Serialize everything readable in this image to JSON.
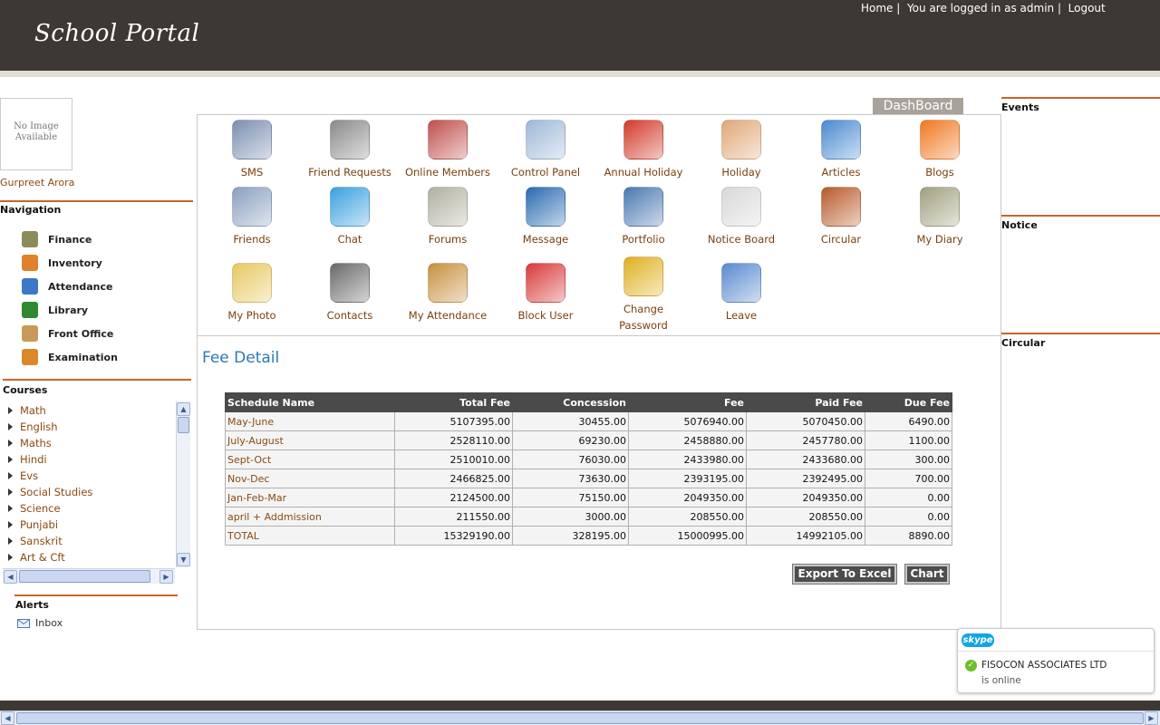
{
  "header": {
    "logo": "School Portal",
    "links": {
      "home": "Home |",
      "logged_in": "You are logged in as admin |",
      "logout": "Logout"
    }
  },
  "profile": {
    "no_image_line1": "No Image",
    "no_image_line2": "Available",
    "name": "Gurpreet Arora"
  },
  "navigation": {
    "title": "Navigation",
    "items": [
      {
        "label": "Finance",
        "icon": "finance-icon",
        "color": "#8c8c5a"
      },
      {
        "label": "Inventory",
        "icon": "inventory-icon",
        "color": "#e0822c"
      },
      {
        "label": "Attendance",
        "icon": "attendance-icon",
        "color": "#3c78c8"
      },
      {
        "label": "Library",
        "icon": "library-icon",
        "color": "#2e8a2e"
      },
      {
        "label": "Front Office",
        "icon": "front-office-icon",
        "color": "#c89a5a"
      },
      {
        "label": "Examination",
        "icon": "examination-icon",
        "color": "#d88a2a"
      }
    ]
  },
  "courses": {
    "title": "Courses",
    "items": [
      "Math",
      "English",
      "Maths",
      "Hindi",
      "Evs",
      "Social Studies",
      "Science",
      "Punjabi",
      "Sanskrit",
      "Art & Cft"
    ]
  },
  "alerts": {
    "title": "Alerts",
    "inbox": "Inbox"
  },
  "dashboard": {
    "tag": "DashBoard",
    "tiles": [
      {
        "label": "SMS",
        "icon": "sms-icon",
        "color": "#7a8fb0"
      },
      {
        "label": "Friend Requests",
        "icon": "friend-requests-icon",
        "color": "#8a8a8a"
      },
      {
        "label": "Online Members",
        "icon": "online-members-icon",
        "color": "#c0504d"
      },
      {
        "label": "Control Panel",
        "icon": "control-panel-icon",
        "color": "#9fb8d8"
      },
      {
        "label": "Annual Holiday",
        "icon": "calendar-icon",
        "color": "#d23a2a"
      },
      {
        "label": "Holiday",
        "icon": "thumbs-up-icon",
        "color": "#e0a878"
      },
      {
        "label": "Articles",
        "icon": "articles-icon",
        "color": "#4a8ad0"
      },
      {
        "label": "Blogs",
        "icon": "rss-icon",
        "color": "#f07820"
      },
      {
        "label": "Friends",
        "icon": "friends-icon",
        "color": "#8aa0c0"
      },
      {
        "label": "Chat",
        "icon": "chat-icon",
        "color": "#3aa0e0"
      },
      {
        "label": "Forums",
        "icon": "forums-icon",
        "color": "#b0b0a0"
      },
      {
        "label": "Message",
        "icon": "message-icon",
        "color": "#2a6ab0"
      },
      {
        "label": "Portfolio",
        "icon": "portfolio-icon",
        "color": "#4a78b0"
      },
      {
        "label": "Notice Board",
        "icon": "notice-board-icon",
        "color": "#d8d8d8"
      },
      {
        "label": "Circular",
        "icon": "circular-icon",
        "color": "#b85a2a"
      },
      {
        "label": "My Diary",
        "icon": "diary-icon",
        "color": "#a0a080"
      },
      {
        "label": "My Photo",
        "icon": "photo-icon",
        "color": "#e8c860"
      },
      {
        "label": "Contacts",
        "icon": "contacts-icon",
        "color": "#6a6a6a"
      },
      {
        "label": "My Attendance",
        "icon": "my-attendance-icon",
        "color": "#c89040"
      },
      {
        "label": "Block User",
        "icon": "block-user-icon",
        "color": "#d83a3a"
      },
      {
        "label": "Change Password",
        "icon": "key-icon",
        "color": "#e0b020"
      },
      {
        "label": "Leave",
        "icon": "leave-icon",
        "color": "#5a8ad0"
      }
    ]
  },
  "fee_detail": {
    "title": "Fee Detail",
    "columns": [
      "Schedule Name",
      "Total Fee",
      "Concession",
      "Fee",
      "Paid Fee",
      "Due Fee"
    ],
    "rows": [
      [
        "May-June",
        "5107395.00",
        "30455.00",
        "5076940.00",
        "5070450.00",
        "6490.00"
      ],
      [
        "July-August",
        "2528110.00",
        "69230.00",
        "2458880.00",
        "2457780.00",
        "1100.00"
      ],
      [
        "Sept-Oct",
        "2510010.00",
        "76030.00",
        "2433980.00",
        "2433680.00",
        "300.00"
      ],
      [
        "Nov-Dec",
        "2466825.00",
        "73630.00",
        "2393195.00",
        "2392495.00",
        "700.00"
      ],
      [
        "Jan-Feb-Mar",
        "2124500.00",
        "75150.00",
        "2049350.00",
        "2049350.00",
        "0.00"
      ],
      [
        "april + Addmission",
        "211550.00",
        "3000.00",
        "208550.00",
        "208550.00",
        "0.00"
      ],
      [
        "TOTAL",
        "15329190.00",
        "328195.00",
        "15000995.00",
        "14992105.00",
        "8890.00"
      ]
    ],
    "export_button": "Export To Excel",
    "chart_button": "Chart"
  },
  "right_panel": {
    "events": "Events",
    "notice": "Notice",
    "circular": "Circular"
  },
  "skype": {
    "brand": "skype",
    "contact": "FISOCON ASSOCIATES LTD",
    "status": "is online"
  },
  "colors": {
    "header_bg": "#3e3834",
    "accent_orange": "#c8652a",
    "link_brown": "#8a4b10",
    "title_blue": "#2a7ab0"
  }
}
